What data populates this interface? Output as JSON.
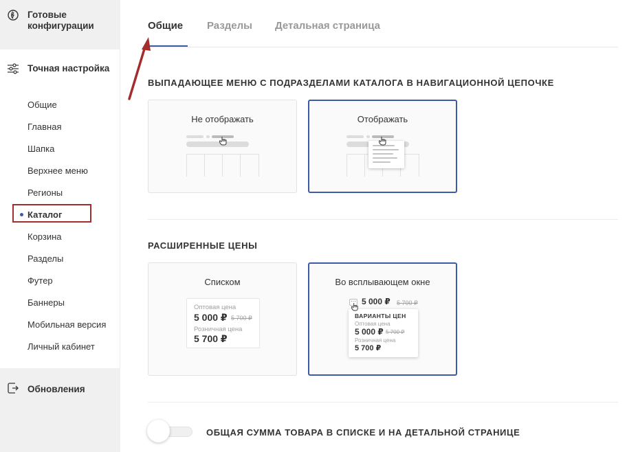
{
  "sidebar": {
    "ready_configs": "Готовые конфигурации",
    "fine_tuning": "Точная настройка",
    "items": [
      {
        "label": "Общие"
      },
      {
        "label": "Главная"
      },
      {
        "label": "Шапка"
      },
      {
        "label": "Верхнее меню"
      },
      {
        "label": "Регионы"
      },
      {
        "label": "Каталог",
        "active": true
      },
      {
        "label": "Корзина"
      },
      {
        "label": "Разделы"
      },
      {
        "label": "Футер"
      },
      {
        "label": "Баннеры"
      },
      {
        "label": "Мобильная версия"
      },
      {
        "label": "Личный кабинет"
      }
    ],
    "updates": "Обновления"
  },
  "tabs": [
    {
      "label": "Общие",
      "active": true
    },
    {
      "label": "Разделы"
    },
    {
      "label": "Детальная страница"
    }
  ],
  "breadcrumb_section": {
    "title": "ВЫПАДАЮЩЕЕ МЕНЮ С ПОДРАЗДЕЛАМИ КАТАЛОГА В НАВИГАЦИОННОЙ ЦЕПОЧКЕ",
    "options": [
      {
        "label": "Не отображать",
        "selected": false
      },
      {
        "label": "Отображать",
        "selected": true
      }
    ]
  },
  "prices_section": {
    "title": "РАСШИРЕННЫЕ ЦЕНЫ",
    "options": [
      {
        "label": "Списком",
        "selected": false,
        "wholesale_label": "Оптовая цена",
        "wholesale_price": "5 000 ₽",
        "wholesale_old": "5 700 ₽",
        "retail_label": "Розничная цена",
        "retail_price": "5 700 ₽"
      },
      {
        "label": "Во всплывающем окне",
        "selected": true,
        "dots": "···",
        "main_price": "5 000 ₽",
        "main_old": "5 700 ₽",
        "popup_title": "ВАРИАНТЫ ЦЕН",
        "wholesale_label": "Оптовая цена",
        "wholesale_price": "5 000 ₽",
        "wholesale_old": "5 700 ₽",
        "retail_label": "Розничная цена",
        "retail_price": "5 700 ₽"
      }
    ]
  },
  "total_toggle": {
    "label": "ОБЩАЯ СУММА ТОВАРА В СПИСКЕ И НА ДЕТАЛЬНОЙ СТРАНИЦЕ",
    "on": false
  },
  "colors": {
    "accent": "#3b5ba9",
    "highlight": "#a32d2d"
  }
}
